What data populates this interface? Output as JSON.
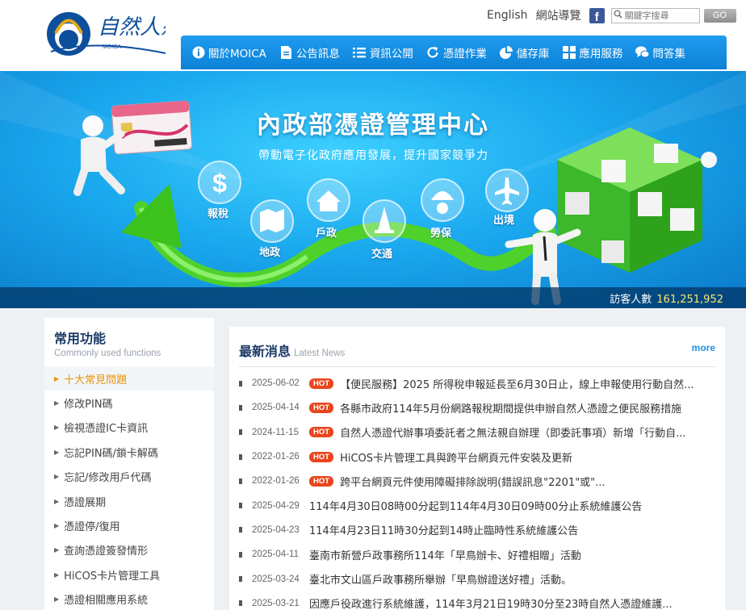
{
  "header": {
    "logo_text": "自然人憑證",
    "logo_sub": "MOICA",
    "links": {
      "english": "English",
      "sitemap": "網站導覽"
    },
    "search_placeholder": "關鍵字搜尋",
    "go_label": "GO"
  },
  "nav": {
    "items": [
      {
        "label": "關於MOICA",
        "icon": "info-icon"
      },
      {
        "label": "公告訊息",
        "icon": "document-icon"
      },
      {
        "label": "資訊公開",
        "icon": "list-icon"
      },
      {
        "label": "憑證作業",
        "icon": "refresh-icon"
      },
      {
        "label": "儲存庫",
        "icon": "pie-icon"
      },
      {
        "label": "應用服務",
        "icon": "grid-icon"
      },
      {
        "label": "問答集",
        "icon": "chat-icon"
      }
    ]
  },
  "banner": {
    "title": "內政部憑證管理中心",
    "subtitle": "帶動電子化政府應用發展，提升國家競爭力",
    "bubbles": [
      "報稅",
      "地政",
      "戶政",
      "交通",
      "勞保",
      "出境"
    ],
    "visitor_label": "訪客人數",
    "visitor_count": "161,251,952"
  },
  "sidebar": {
    "title": "常用功能",
    "subtitle": "Commonly used functions",
    "items": [
      "十大常見問題",
      "修改PIN碼",
      "檢視憑證IC卡資訊",
      "忘記PIN碼/鎖卡解碼",
      "忘記/修改用戶代碼",
      "憑證展期",
      "憑證停/復用",
      "查詢憑證簽發情形",
      "HiCOS卡片管理工具",
      "憑證相關應用系統"
    ]
  },
  "news": {
    "title": "最新消息",
    "title_en": "Latest News",
    "more": "more",
    "hot_label": "HOT",
    "items": [
      {
        "date": "2025-06-02",
        "hot": true,
        "text": "【便民服務】2025 所得稅申報延長至6月30日止，線上申報使用行動自然..."
      },
      {
        "date": "2025-04-14",
        "hot": true,
        "text": "各縣市政府114年5月份網路報稅期間提供申辦自然人憑證之便民服務措施"
      },
      {
        "date": "2024-11-15",
        "hot": true,
        "text": "自然人憑證代辦事項委託者之無法親自辦理（即委託事項）新增「行動自..."
      },
      {
        "date": "2022-01-26",
        "hot": true,
        "text": "HiCOS卡片管理工具與跨平台網頁元件安裝及更新"
      },
      {
        "date": "2022-01-26",
        "hot": true,
        "text": "跨平台網頁元件使用障礙排除說明(錯誤訊息\"2201\"或\"..."
      },
      {
        "date": "2025-04-29",
        "hot": false,
        "text": "114年4月30日08時00分起到114年4月30日09時00分止系統維護公告"
      },
      {
        "date": "2025-04-23",
        "hot": false,
        "text": "114年4月23日11時30分起到14時止臨時性系統維護公告"
      },
      {
        "date": "2025-04-11",
        "hot": false,
        "text": "臺南市新營戶政事務所114年「早鳥辦卡、好禮相贈」活動"
      },
      {
        "date": "2025-03-24",
        "hot": false,
        "text": "臺北市文山區戶政事務所舉辦「早鳥辦證送好禮」活動。"
      },
      {
        "date": "2025-03-21",
        "hot": false,
        "text": "因應戶役政進行系統維護，114年3月21日19時30分至23時自然人憑證維護..."
      }
    ]
  },
  "colors": {
    "nav": "#0c82d6",
    "accent": "#e8920a",
    "hot": "#e8461e",
    "title": "#1a3a66"
  }
}
